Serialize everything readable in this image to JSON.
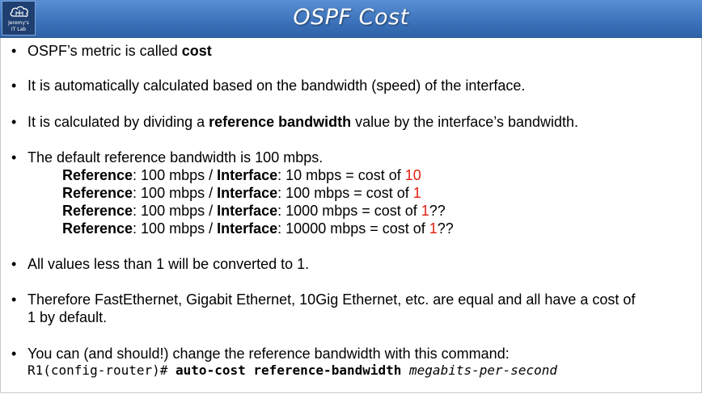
{
  "header": {
    "title": "OSPF Cost",
    "logo_line1": "Jeremy's",
    "logo_line2": "IT Lab",
    "logo_icon": "cloud-network-icon"
  },
  "colors": {
    "header_blue": "#3d74bd",
    "highlight_red": "#e02010"
  },
  "bullets": {
    "b1": {
      "text": "OSPF’s metric is called ",
      "bold": "cost"
    },
    "b2": {
      "text": "It is automatically calculated based on the bandwidth (speed) of the interface."
    },
    "b3": {
      "pre": "It is calculated by dividing a ",
      "bold": "reference bandwidth",
      "post": " value by the interface’s bandwidth."
    },
    "b4": {
      "text": "The default reference bandwidth is 100 mbps."
    },
    "b5": {
      "text": "All values less than 1 will be converted to 1."
    },
    "b6": {
      "line1": "Therefore FastEthernet, Gigabit Ethernet, 10Gig Ethernet, etc. are equal and all have a cost of",
      "line2": "1 by default."
    },
    "b7": {
      "text": "You can (and should!) change the reference bandwidth with this command:",
      "prompt": "R1(config-router)# ",
      "command": "auto-cost reference-bandwidth",
      "argument": "megabits-per-second"
    }
  },
  "examples": [
    {
      "ref_label": "Reference",
      "ref_value": ": 100 mbps / ",
      "if_label": "Interface",
      "if_value": ": 10 mbps = cost of ",
      "cost": "10",
      "suffix": ""
    },
    {
      "ref_label": "Reference",
      "ref_value": ": 100 mbps / ",
      "if_label": "Interface",
      "if_value": ": 100 mbps = cost of ",
      "cost": "1",
      "suffix": ""
    },
    {
      "ref_label": "Reference",
      "ref_value": ": 100 mbps / ",
      "if_label": "Interface",
      "if_value": ": 1000 mbps = cost of ",
      "cost": "1",
      "suffix": "??"
    },
    {
      "ref_label": "Reference",
      "ref_value": ": 100 mbps / ",
      "if_label": "Interface",
      "if_value": ": 10000 mbps = cost of ",
      "cost": "1",
      "suffix": "??"
    }
  ]
}
